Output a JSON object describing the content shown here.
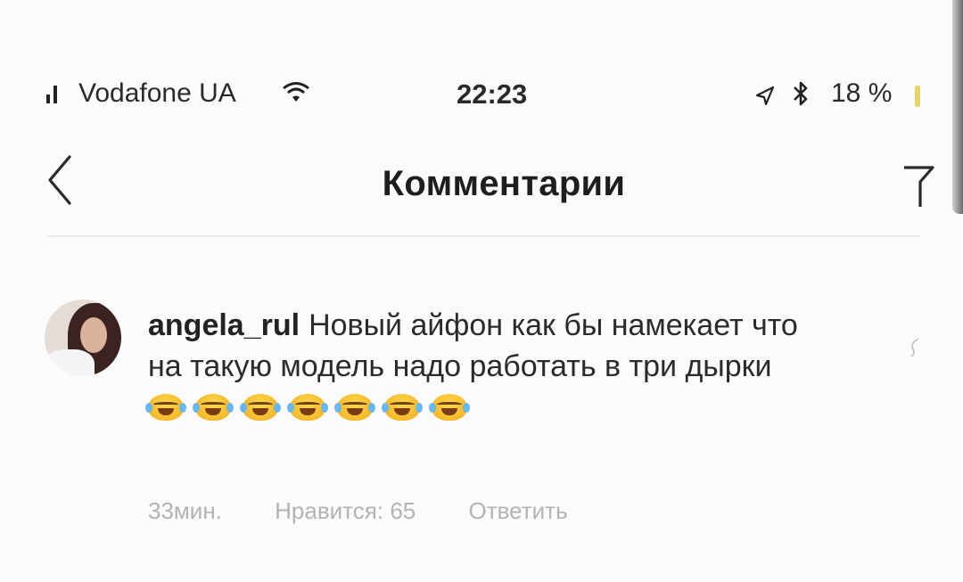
{
  "status_bar": {
    "carrier": "Vodafone UA",
    "time": "22:23",
    "battery": "18 %",
    "icons": [
      "signal-icon",
      "wifi-icon",
      "location-icon",
      "bluetooth-icon",
      "battery-icon"
    ]
  },
  "header": {
    "title": "Комментарии",
    "back_icon": "chevron-left-icon",
    "filter_icon": "filter-icon"
  },
  "comment": {
    "username": "angela_rul",
    "text": "Новый айфон  как бы намекает что на такую модель надо работать в три дырки",
    "emoji": [
      "😂",
      "😂",
      "😂",
      "😂",
      "😂",
      "😂",
      "😂"
    ],
    "time": "33мин.",
    "likes": "Нравится: 65",
    "reply": "Ответить",
    "like_icon": "heart-icon"
  },
  "colors": {
    "background": "#fbfbfb",
    "text": "#262626",
    "meta": "#b3b3b3",
    "divider": "#ececec"
  }
}
